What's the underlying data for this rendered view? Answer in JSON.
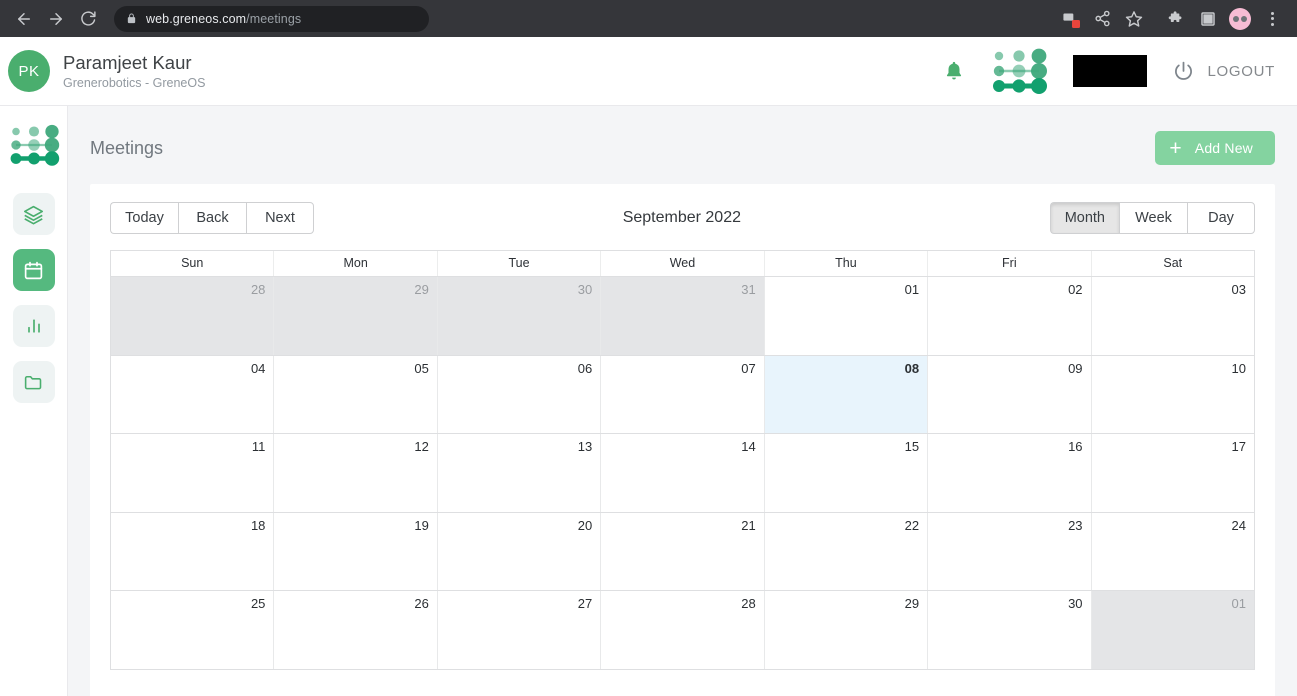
{
  "browser": {
    "url_host": "web.greneos.com",
    "url_path": "/meetings",
    "back_icon": "back-arrow-icon",
    "forward_icon": "forward-arrow-icon",
    "reload_icon": "reload-icon",
    "lock_icon": "lock-icon",
    "actions": [
      {
        "name": "cast-icon"
      },
      {
        "name": "share-icon"
      },
      {
        "name": "bookmark-star-icon"
      },
      {
        "name": "extensions-puzzle-icon"
      },
      {
        "name": "sidepanel-icon"
      },
      {
        "name": "profile-avatar-icon"
      },
      {
        "name": "chrome-menu-icon"
      }
    ]
  },
  "header": {
    "avatar_initials": "PK",
    "user_name": "Paramjeet Kaur",
    "user_org": "Grenerobotics - GreneOS",
    "bell_icon": "notification-bell-icon",
    "brand_logo_icon": "greneos-node-logo-icon",
    "redacted_icon": "redacted-block",
    "power_icon": "power-icon",
    "logout_label": "LOGOUT"
  },
  "sidebar": {
    "logo_icon": "greneos-node-logo-icon",
    "items": [
      {
        "name": "sidebar-item-layers",
        "icon": "layers-icon",
        "active": false
      },
      {
        "name": "sidebar-item-calendar",
        "icon": "calendar-icon",
        "active": true
      },
      {
        "name": "sidebar-item-reports",
        "icon": "bar-chart-icon",
        "active": false
      },
      {
        "name": "sidebar-item-files",
        "icon": "folder-icon",
        "active": false
      }
    ]
  },
  "main": {
    "page_title": "Meetings",
    "add_new_label": "Add New",
    "add_new_icon": "plus-icon",
    "toolbar": {
      "today_label": "Today",
      "back_label": "Back",
      "next_label": "Next",
      "current_label": "September 2022",
      "month_label": "Month",
      "week_label": "Week",
      "day_label": "Day",
      "active_view": "Month"
    },
    "calendar": {
      "day_headers": [
        "Sun",
        "Mon",
        "Tue",
        "Wed",
        "Thu",
        "Fri",
        "Sat"
      ],
      "today": "08",
      "weeks": [
        [
          {
            "label": "28",
            "off": true
          },
          {
            "label": "29",
            "off": true
          },
          {
            "label": "30",
            "off": true
          },
          {
            "label": "31",
            "off": true
          },
          {
            "label": "01",
            "off": false
          },
          {
            "label": "02",
            "off": false
          },
          {
            "label": "03",
            "off": false
          }
        ],
        [
          {
            "label": "04",
            "off": false
          },
          {
            "label": "05",
            "off": false
          },
          {
            "label": "06",
            "off": false
          },
          {
            "label": "07",
            "off": false
          },
          {
            "label": "08",
            "off": false,
            "today": true
          },
          {
            "label": "09",
            "off": false
          },
          {
            "label": "10",
            "off": false
          }
        ],
        [
          {
            "label": "11",
            "off": false
          },
          {
            "label": "12",
            "off": false
          },
          {
            "label": "13",
            "off": false
          },
          {
            "label": "14",
            "off": false
          },
          {
            "label": "15",
            "off": false
          },
          {
            "label": "16",
            "off": false
          },
          {
            "label": "17",
            "off": false
          }
        ],
        [
          {
            "label": "18",
            "off": false
          },
          {
            "label": "19",
            "off": false
          },
          {
            "label": "20",
            "off": false
          },
          {
            "label": "21",
            "off": false
          },
          {
            "label": "22",
            "off": false
          },
          {
            "label": "23",
            "off": false
          },
          {
            "label": "24",
            "off": false
          }
        ],
        [
          {
            "label": "25",
            "off": false
          },
          {
            "label": "26",
            "off": false
          },
          {
            "label": "27",
            "off": false
          },
          {
            "label": "28",
            "off": false
          },
          {
            "label": "29",
            "off": false
          },
          {
            "label": "30",
            "off": false
          },
          {
            "label": "01",
            "off": true
          }
        ]
      ]
    }
  },
  "colors": {
    "brand_green": "#4aae6e",
    "active_green": "#55b97f",
    "add_new_green": "#84d3a0",
    "today_blue": "#e8f4fc",
    "chrome_dark": "#35363a"
  }
}
